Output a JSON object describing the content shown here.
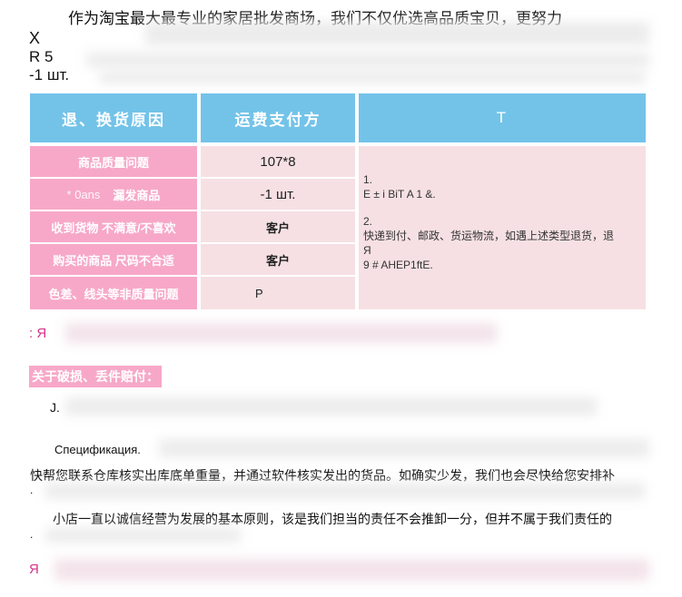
{
  "intro_text": "作为淘宝最大最专业的家居批发商场，我们不仅优选高品质宝贝，更努力",
  "header": {
    "x_label": "X",
    "r_label": "R 5",
    "qty_label": "-1 шт."
  },
  "table": {
    "headers": [
      "退、换货原因",
      "运费支付方",
      "T"
    ],
    "rows": [
      {
        "reason": "商品质量问题",
        "payer": "107*8"
      },
      {
        "reason_prefix": "* 0ans",
        "reason": "漏发商品",
        "payer": "-1 шт."
      },
      {
        "reason": "收到货物 不满意/不喜欢",
        "payer": "客户"
      },
      {
        "reason": "购买的商品 尺码不合适",
        "payer": "客户"
      },
      {
        "reason": "色差、线头等非质量问题",
        "payer": "P"
      }
    ],
    "notes": {
      "n1_num": "1.",
      "n1_text": "E ± i BiT A 1 &.",
      "n2_num": "2.",
      "n2_text": "快递到付、邮政、货运物流，如遇上述类型退货，退",
      "n2_cont": "Я",
      "n2_tail": "9 # AHEP1ftE."
    }
  },
  "section1_marker": ": Я",
  "damage_title": "关于破损、丢件赔付：",
  "damage_line": "J.",
  "spec_label": "Спецификация.",
  "para1": "快帮您联系仓库核实出库底单重量，并通过软件核实发出的货品。如确实少发，我们也会尽快给您安排补",
  "para1_end": ".",
  "para2": "小店一直以诚信经营为发展的基本原则，该是我们担当的责任不会推卸一分，但并不属于我们责任的",
  "para2_end": ".",
  "footer_marker": "Я"
}
